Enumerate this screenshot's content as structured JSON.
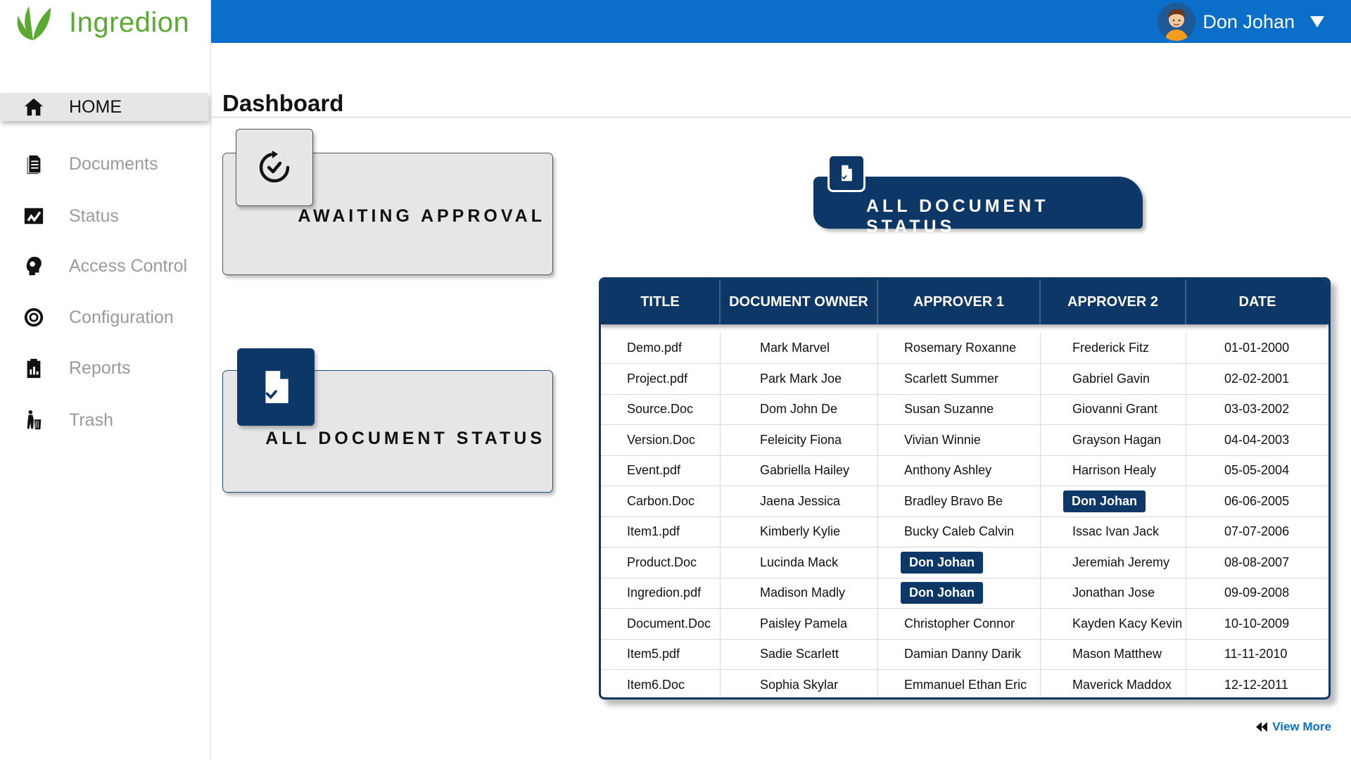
{
  "brand": {
    "name": "Ingredion",
    "color": "#5aaa32"
  },
  "user": {
    "name": "Don Johan"
  },
  "sidebar": {
    "items": [
      {
        "label": "HOME",
        "icon": "home-icon",
        "active": true
      },
      {
        "label": "Documents",
        "icon": "documents-icon"
      },
      {
        "label": "Status",
        "icon": "status-chart-icon"
      },
      {
        "label": "Access Control",
        "icon": "access-control-icon"
      },
      {
        "label": "Configuration",
        "icon": "configuration-gear-icon"
      },
      {
        "label": "Reports",
        "icon": "reports-icon"
      },
      {
        "label": "Trash",
        "icon": "trash-icon"
      }
    ]
  },
  "page": {
    "title": "Dashboard"
  },
  "cards": {
    "awaiting": {
      "label": "AWAITING APPROVAL",
      "icon": "refresh-check-icon"
    },
    "all_status": {
      "label": "ALL DOCUMENT STATUS",
      "icon": "document-icon"
    }
  },
  "banner": {
    "label": "ALL DOCUMENT STATUS",
    "icon": "document-icon"
  },
  "table": {
    "columns": [
      "TITLE",
      "DOCUMENT OWNER",
      "APPROVER 1",
      "APPROVER 2",
      "DATE"
    ],
    "rows": [
      [
        "Demo.pdf",
        "Mark Marvel",
        "Rosemary Roxanne",
        "Frederick Fitz",
        "01-01-2000"
      ],
      [
        "Project.pdf",
        "Park Mark Joe",
        "Scarlett Summer",
        "Gabriel Gavin",
        "02-02-2001"
      ],
      [
        "Source.Doc",
        "Dom John De",
        "Susan Suzanne",
        "Giovanni Grant",
        "03-03-2002"
      ],
      [
        "Version.Doc",
        "Feleicity Fiona",
        "Vivian Winnie",
        "Grayson Hagan",
        "04-04-2003"
      ],
      [
        "Event.pdf",
        "Gabriella Hailey",
        "Anthony Ashley",
        "Harrison Healy",
        "05-05-2004"
      ],
      [
        "Carbon.Doc",
        "Jaena Jessica",
        "Bradley Bravo Be",
        "Don Johan",
        "06-06-2005"
      ],
      [
        "Item1.pdf",
        "Kimberly Kylie",
        "Bucky Caleb Calvin",
        "Issac Ivan Jack",
        "07-07-2006"
      ],
      [
        "Product.Doc",
        "Lucinda Mack",
        "Don Johan",
        "Jeremiah Jeremy",
        "08-08-2007"
      ],
      [
        "Ingredion.pdf",
        "Madison Madly",
        "Don Johan",
        "Jonathan Jose",
        "09-09-2008"
      ],
      [
        "Document.Doc",
        "Paisley Pamela",
        "Christopher Connor",
        "Kayden Kacy Kevin",
        "10-10-2009"
      ],
      [
        "Item5.pdf",
        "Sadie Scarlett",
        "Damian Danny Darik",
        "Mason Matthew",
        "11-11-2010"
      ],
      [
        "Item6.Doc",
        "Sophia Skylar",
        "Emmanuel Ethan Eric",
        "Maverick Maddox",
        "12-12-2011"
      ]
    ]
  },
  "view_more": {
    "label": "View More",
    "icon": "rewind-icon"
  },
  "colors": {
    "topbar": "#0b6fc9",
    "navy": "#0d3766",
    "card_bg": "#e6e6e6"
  }
}
